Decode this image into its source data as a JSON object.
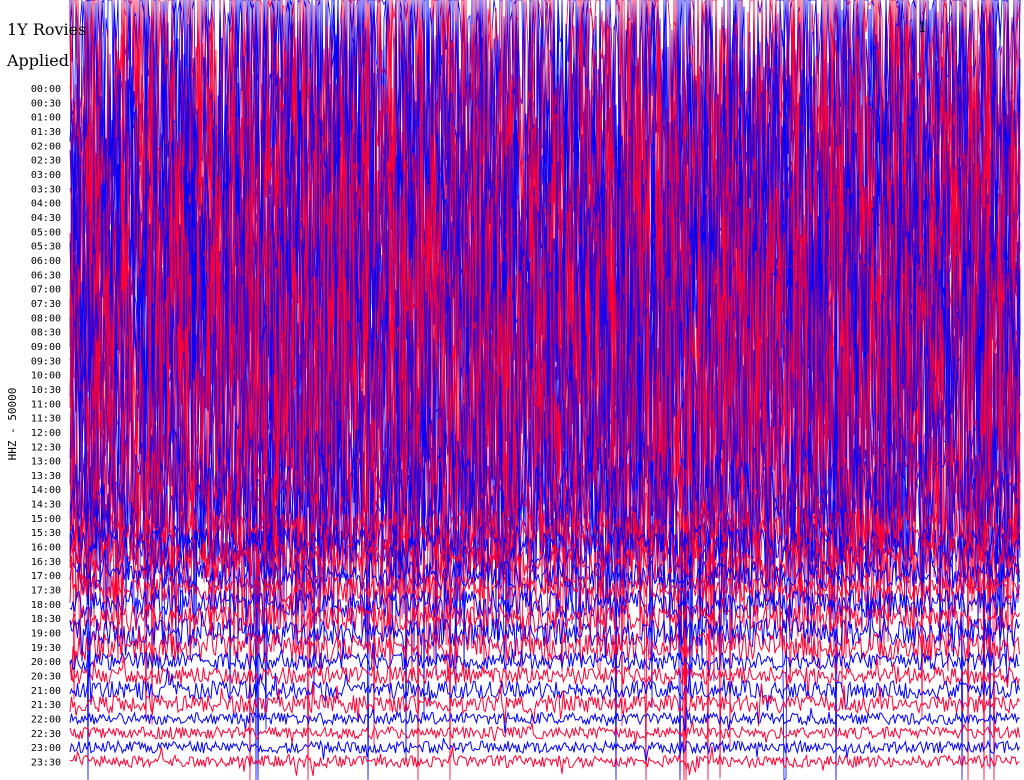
{
  "header": {
    "title_line1": "1Y Rovies",
    "title_line2": "Applied",
    "title_right": "1"
  },
  "colors": {
    "trace_a": "#0000ff",
    "trace_b": "#ff0033",
    "background": "#ffffff",
    "text": "#000000"
  },
  "chart_data": {
    "type": "line",
    "title": "",
    "xlabel": "",
    "ylabel": "HHZ  - 50000",
    "row_labels": [
      "00:00",
      "00:30",
      "01:00",
      "01:30",
      "02:00",
      "02:30",
      "03:00",
      "03:30",
      "04:00",
      "04:30",
      "05:00",
      "05:30",
      "06:00",
      "06:30",
      "07:00",
      "07:30",
      "08:00",
      "08:30",
      "09:00",
      "09:30",
      "10:00",
      "10:30",
      "11:00",
      "11:30",
      "12:00",
      "12:30",
      "13:00",
      "13:30",
      "14:00",
      "14:30",
      "15:00",
      "15:30",
      "16:00",
      "16:30",
      "17:00",
      "17:30",
      "18:00",
      "18:30",
      "19:00",
      "19:30",
      "20:00",
      "20:30",
      "21:00",
      "21:30",
      "22:00",
      "22:30",
      "23:00",
      "23:30"
    ],
    "trace_colors": [
      "#0000ff",
      "#ff0033"
    ],
    "grid": false,
    "legend": "none"
  }
}
